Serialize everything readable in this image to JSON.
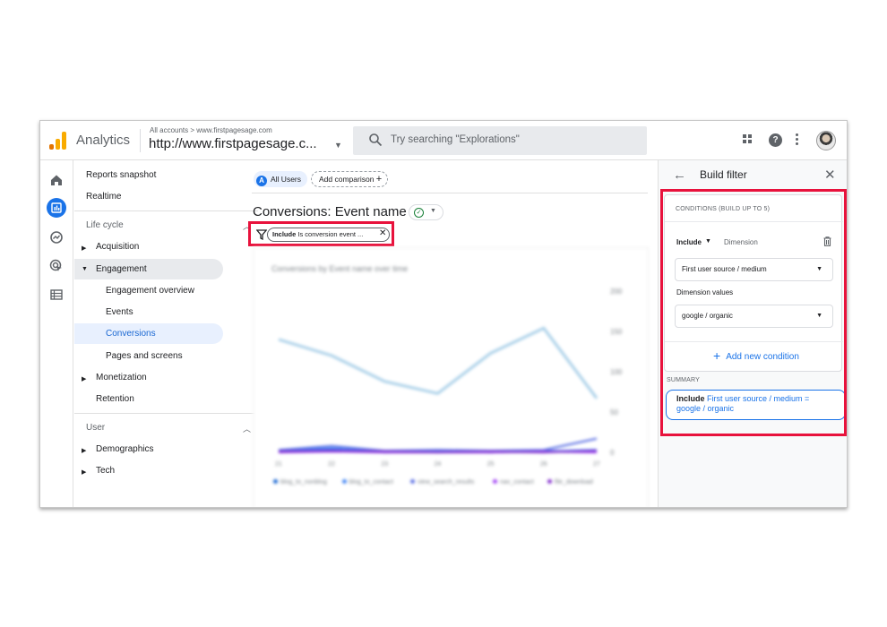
{
  "header": {
    "app_name": "Analytics",
    "breadcrumb": "All accounts > www.firstpagesage.com",
    "property": "http://www.firstpagesage.c...",
    "search_placeholder": "Try searching \"Explorations\"",
    "icons": [
      "apps-icon",
      "help-icon",
      "more-vert-icon",
      "avatar"
    ]
  },
  "rail": {
    "icons": [
      "home-icon",
      "reports-icon",
      "explore-icon",
      "advertising-icon",
      "configure-icon"
    ],
    "active": "reports-icon"
  },
  "nav": {
    "reports_snapshot": "Reports snapshot",
    "realtime": "Realtime",
    "lifecycle": "Life cycle",
    "acquisition": "Acquisition",
    "engagement": "Engagement",
    "engagement_overview": "Engagement overview",
    "events": "Events",
    "conversions": "Conversions",
    "pages_and_screens": "Pages and screens",
    "monetization": "Monetization",
    "retention": "Retention",
    "user": "User",
    "demographics": "Demographics",
    "tech": "Tech"
  },
  "main": {
    "comparison_chip_letter": "A",
    "comparison_chip": "All Users",
    "add_comparison": "Add comparison",
    "report_title": "Conversions: Event name",
    "filter_chip_bold": "Include",
    "filter_chip_text": "Is conversion event ..."
  },
  "chart_data": {
    "type": "line",
    "title": "Conversions by Event name over time",
    "x": [
      "21",
      "22",
      "23",
      "24",
      "25",
      "26",
      "27"
    ],
    "ylim": [
      0,
      200
    ],
    "yticks": [
      "200",
      "150",
      "100",
      "50",
      "0"
    ],
    "series": [
      {
        "name": "blog_to_nonblog",
        "color": "#1967d2",
        "values": [
          1,
          3,
          0,
          1,
          0,
          2,
          1
        ]
      },
      {
        "name": "blog_to_contact",
        "color": "#4285f4",
        "values": [
          2,
          5,
          1,
          2,
          1,
          1,
          3
        ]
      },
      {
        "name": "view_search_results",
        "color": "#5e72e4",
        "values": [
          3,
          8,
          2,
          3,
          2,
          3,
          17
        ]
      },
      {
        "name": "nav_contact",
        "color": "#a142f4",
        "values": [
          0,
          1,
          0,
          0,
          0,
          1,
          0
        ]
      },
      {
        "name": "file_download",
        "color": "#8430ce",
        "values": [
          1,
          2,
          1,
          0,
          1,
          0,
          2
        ]
      }
    ],
    "unlabeled_series": [
      {
        "color": "#a8cfe8",
        "values": [
          140,
          120,
          88,
          73,
          123,
          154,
          67
        ]
      }
    ]
  },
  "panel": {
    "title": "Build filter",
    "conditions_header": "CONDITIONS (BUILD UP TO 5)",
    "include_label": "Include",
    "dimension_label": "Dimension",
    "dimension_value": "First user source / medium",
    "dimension_values_label": "Dimension values",
    "dimension_values_value": "google / organic",
    "add_condition": "Add new condition",
    "summary_label": "SUMMARY",
    "summary_bold": "Include",
    "summary_text": "First user source / medium = google / organic"
  },
  "colors": {
    "accent": "#1a73e8",
    "highlight_box": "#e8123c",
    "logo_orange": "#f9ab00",
    "logo_dark_orange": "#e37400"
  }
}
